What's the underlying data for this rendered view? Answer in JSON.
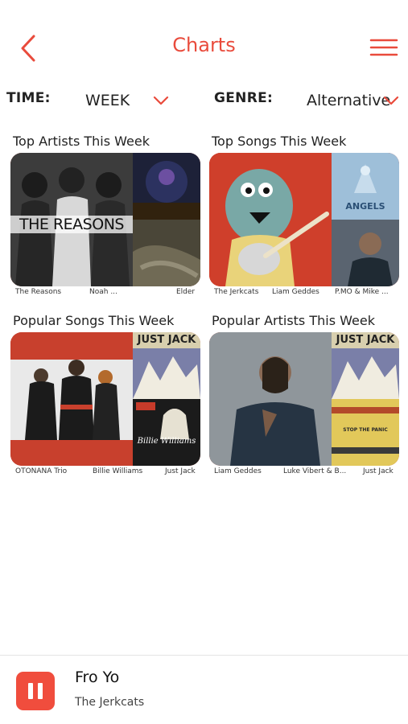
{
  "header": {
    "title": "Charts",
    "back_icon": "chevron-left-icon",
    "menu_icon": "hamburger-menu-icon",
    "accent": "#e94b3c"
  },
  "filters": {
    "time_label": "TIME:",
    "time_value": "WEEK",
    "genre_label": "GENRE:",
    "genre_value": "Alternative"
  },
  "cards": [
    {
      "title": "Top Artists This Week",
      "main_text": "THE REASONS",
      "names": [
        "The Reasons",
        "Noah ...",
        "Elder"
      ]
    },
    {
      "title": "Top Songs This Week",
      "side_text": "ANGELS",
      "names": [
        "The Jerkcats",
        "Liam Geddes",
        "P.MO & Mike ..."
      ]
    },
    {
      "title": "Popular Songs This Week",
      "side_text_1": "JUST JACK",
      "side_text_2": "Billie Williams",
      "names": [
        "OTONANA Trio",
        "Billie Williams",
        "Just Jack"
      ]
    },
    {
      "title": "Popular Artists This Week",
      "side_text_1": "JUST JACK",
      "side_text_2": "STOP THE PANIC",
      "names": [
        "Liam Geddes",
        "Luke Vibert & B...",
        "Just Jack"
      ]
    }
  ],
  "player": {
    "song": "Fro Yo",
    "artist": "The Jerkcats",
    "button_icon": "pause-icon",
    "button_color": "#f04d3d"
  }
}
